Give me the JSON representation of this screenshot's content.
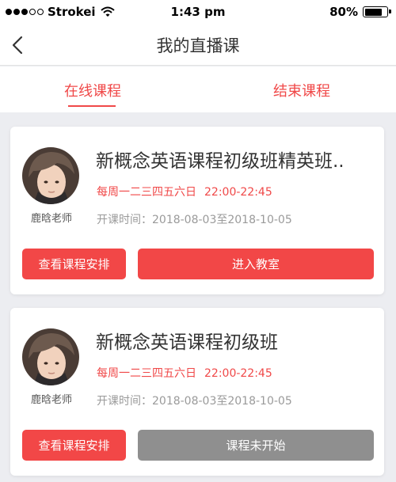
{
  "status_bar": {
    "carrier": "Strokei",
    "time": "1:43 pm",
    "battery": "80%",
    "battery_level": 0.8,
    "signal_icon": "signal-dots-icon",
    "wifi_icon": "wifi-icon",
    "battery_icon": "battery-icon"
  },
  "nav": {
    "title": "我的直播课",
    "back_icon": "chevron-left-icon"
  },
  "tabs": [
    {
      "label": "在线课程",
      "active": true
    },
    {
      "label": "结束课程",
      "active": false
    }
  ],
  "accent_color": "#f24747",
  "disabled_color": "#8f8f8f",
  "courses": [
    {
      "title": "新概念英语课程初级班精英班..",
      "teacher": "鹿晗老师",
      "days": "每周一二三四五六日",
      "time": "22:00-22:45",
      "period": "开课时间：2018-08-03至2018-10-05",
      "schedule_button": "查看课程安排",
      "action_button": "进入教室",
      "action_enabled": true
    },
    {
      "title": "新概念英语课程初级班",
      "teacher": "鹿晗老师",
      "days": "每周一二三四五六日",
      "time": "22:00-22:45",
      "period": "开课时间：2018-08-03至2018-10-05",
      "schedule_button": "查看课程安排",
      "action_button": "课程未开始",
      "action_enabled": false
    }
  ]
}
